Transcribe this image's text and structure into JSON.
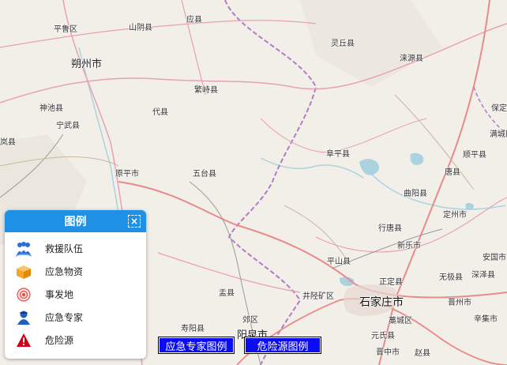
{
  "map": {
    "places": [
      {
        "id": "pinglu",
        "name": "平鲁区"
      },
      {
        "id": "shanyin",
        "name": "山阴县"
      },
      {
        "id": "yingxian",
        "name": "应县"
      },
      {
        "id": "lingqiu",
        "name": "灵丘县"
      },
      {
        "id": "laiyuan",
        "name": "涞源县"
      },
      {
        "id": "shuozhou",
        "name": "朔州市"
      },
      {
        "id": "fanshi",
        "name": "繁峙县"
      },
      {
        "id": "shenchi",
        "name": "神池县"
      },
      {
        "id": "daixian",
        "name": "代县"
      },
      {
        "id": "ningwu",
        "name": "宁武县"
      },
      {
        "id": "baoding",
        "name": "保定"
      },
      {
        "id": "fuping",
        "name": "阜平县"
      },
      {
        "id": "mancheng",
        "name": "满城区"
      },
      {
        "id": "shunping",
        "name": "顺平县"
      },
      {
        "id": "yuanping",
        "name": "原平市"
      },
      {
        "id": "wutai",
        "name": "五台县"
      },
      {
        "id": "tangxian",
        "name": "唐县"
      },
      {
        "id": "quyang",
        "name": "曲阳县"
      },
      {
        "id": "dingzhou",
        "name": "定州市"
      },
      {
        "id": "xingtang",
        "name": "行唐县"
      },
      {
        "id": "xinle",
        "name": "新乐市"
      },
      {
        "id": "pingshan",
        "name": "平山县"
      },
      {
        "id": "anguo",
        "name": "安国市"
      },
      {
        "id": "zhengding",
        "name": "正定县"
      },
      {
        "id": "wuji",
        "name": "无极县"
      },
      {
        "id": "shenze",
        "name": "深泽县"
      },
      {
        "id": "yuxian",
        "name": "盂县"
      },
      {
        "id": "jingxing",
        "name": "井陉矿区"
      },
      {
        "id": "shijiazhuang",
        "name": "石家庄市"
      },
      {
        "id": "jinzhou",
        "name": "晋州市"
      },
      {
        "id": "shouyang",
        "name": "寿阳县"
      },
      {
        "id": "jiaoqu",
        "name": "郊区"
      },
      {
        "id": "yangquan",
        "name": "阳泉市"
      },
      {
        "id": "gaocheng",
        "name": "藁城区"
      },
      {
        "id": "xinji",
        "name": "辛集市"
      },
      {
        "id": "yuanshi",
        "name": "元氏县"
      },
      {
        "id": "zhaoxian",
        "name": "赵县"
      },
      {
        "id": "jinzhong",
        "name": "晋中市"
      },
      {
        "id": "lanxian",
        "name": "岚县"
      }
    ]
  },
  "legend": {
    "title": "图例",
    "close_symbol": "×",
    "items": [
      {
        "icon": "rescue-team-icon",
        "label": "救援队伍",
        "color": "#2a6fd6"
      },
      {
        "icon": "emergency-supplies-icon",
        "label": "应急物资",
        "color": "#f5a623"
      },
      {
        "icon": "incident-site-icon",
        "label": "事发地",
        "color": "#e24a4a"
      },
      {
        "icon": "emergency-expert-icon",
        "label": "应急专家",
        "color": "#1f5fbf"
      },
      {
        "icon": "hazard-source-icon",
        "label": "危险源",
        "color": "#d0021b"
      }
    ]
  },
  "buttons": {
    "expert_legend": "应急专家图例",
    "hazard_legend": "危险源图例"
  },
  "colors": {
    "map_background": "#f2efe9",
    "province_border": "#b07cc6",
    "main_road": "#e8a0b4",
    "highway": "#e98a8a",
    "water": "#aad3df",
    "legend_header": "#1e90e6",
    "button_bg": "#0c0cf0"
  }
}
